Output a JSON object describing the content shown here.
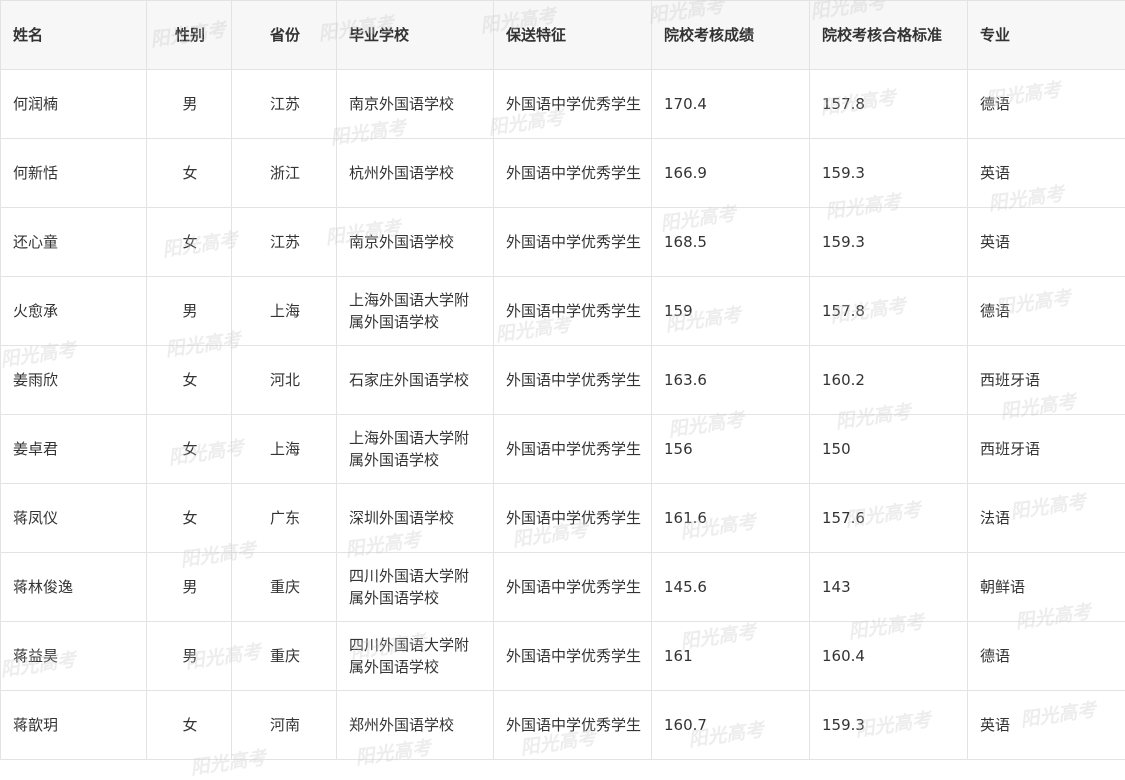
{
  "table": {
    "headers": [
      "姓名",
      "性别",
      "省份",
      "毕业学校",
      "保送特征",
      "院校考核成绩",
      "院校考核合格标准",
      "专业"
    ],
    "rows": [
      [
        "何润楠",
        "男",
        "江苏",
        "南京外国语学校",
        "外国语中学优秀学生",
        "170.4",
        "157.8",
        "德语"
      ],
      [
        "何新恬",
        "女",
        "浙江",
        "杭州外国语学校",
        "外国语中学优秀学生",
        "166.9",
        "159.3",
        "英语"
      ],
      [
        "还心童",
        "女",
        "江苏",
        "南京外国语学校",
        "外国语中学优秀学生",
        "168.5",
        "159.3",
        "英语"
      ],
      [
        "火愈承",
        "男",
        "上海",
        "上海外国语大学附属外国语学校",
        "外国语中学优秀学生",
        "159",
        "157.8",
        "德语"
      ],
      [
        "姜雨欣",
        "女",
        "河北",
        "石家庄外国语学校",
        "外国语中学优秀学生",
        "163.6",
        "160.2",
        "西班牙语"
      ],
      [
        "姜卓君",
        "女",
        "上海",
        "上海外国语大学附属外国语学校",
        "外国语中学优秀学生",
        "156",
        "150",
        "西班牙语"
      ],
      [
        "蒋凤仪",
        "女",
        "广东",
        "深圳外国语学校",
        "外国语中学优秀学生",
        "161.6",
        "157.6",
        "法语"
      ],
      [
        "蒋林俊逸",
        "男",
        "重庆",
        "四川外国语大学附属外国语学校",
        "外国语中学优秀学生",
        "145.6",
        "143",
        "朝鲜语"
      ],
      [
        "蒋益昊",
        "男",
        "重庆",
        "四川外国语大学附属外国语学校",
        "外国语中学优秀学生",
        "161",
        "160.4",
        "德语"
      ],
      [
        "蒋歆玥",
        "女",
        "河南",
        "郑州外国语学校",
        "外国语中学优秀学生",
        "160.7",
        "159.3",
        "英语"
      ]
    ]
  },
  "watermark": {
    "text": "阳光高考"
  },
  "colors": {
    "border": "#e3e3e3",
    "header_bg": "#f7f7f7",
    "text": "#333333"
  }
}
